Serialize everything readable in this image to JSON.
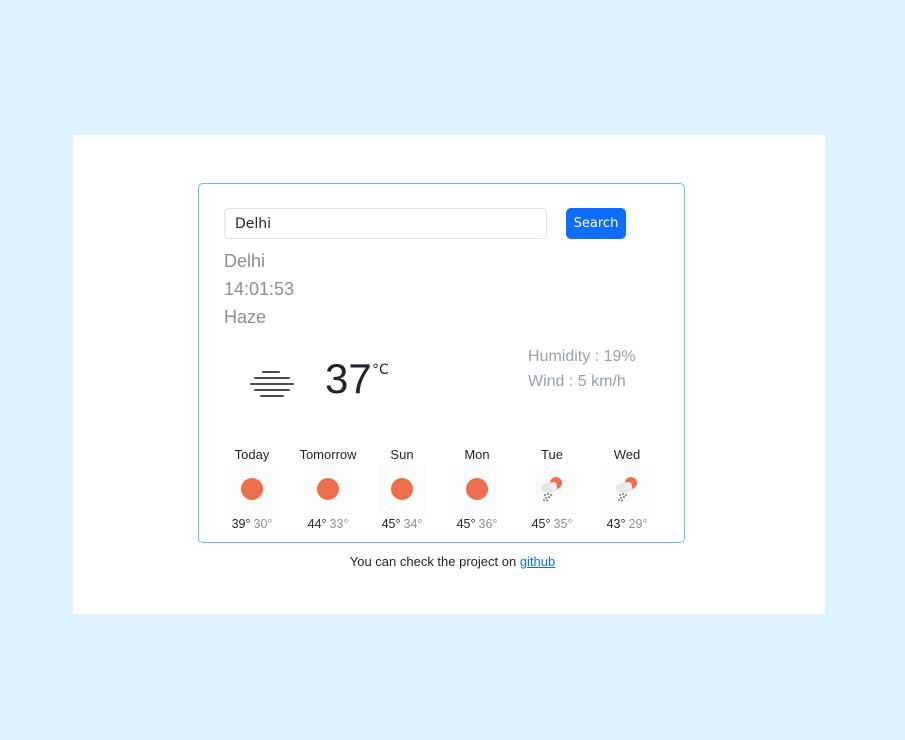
{
  "search": {
    "value": "Delhi",
    "button_label": "Search"
  },
  "current": {
    "city": "Delhi",
    "time": "14:01:53",
    "condition": "Haze",
    "condition_icon": "haze-icon",
    "temperature": "37",
    "unit": "°C",
    "humidity": "Humidity : 19%",
    "wind": "Wind : 5 km/h"
  },
  "forecast": [
    {
      "day": "Today",
      "high": "39°",
      "low": "30°",
      "icon": "sun-icon"
    },
    {
      "day": "Tomorrow",
      "high": "44°",
      "low": "33°",
      "icon": "sun-icon"
    },
    {
      "day": "Sun",
      "high": "45°",
      "low": "34°",
      "icon": "sun-icon"
    },
    {
      "day": "Mon",
      "high": "45°",
      "low": "36°",
      "icon": "sun-icon"
    },
    {
      "day": "Tue",
      "high": "45°",
      "low": "35°",
      "icon": "rain-sun-icon"
    },
    {
      "day": "Wed",
      "high": "43°",
      "low": "29°",
      "icon": "rain-sun-icon"
    }
  ],
  "footer": {
    "text": "You can check the project on ",
    "link": "github"
  },
  "colors": {
    "background": "#dff3fe",
    "accent": "#0d6efd",
    "card_border": "#5cc6dc",
    "sun": "#ec6e4c"
  }
}
